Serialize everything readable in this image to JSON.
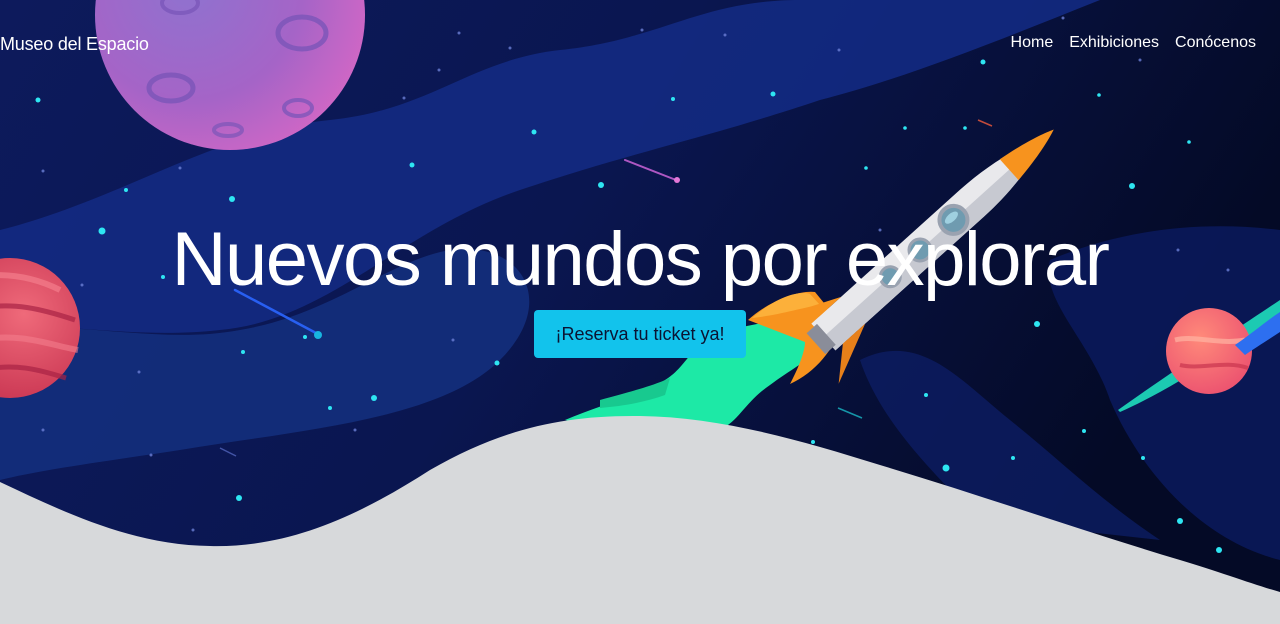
{
  "navbar": {
    "brand": "Museo del Espacio",
    "links": [
      {
        "label": "Home"
      },
      {
        "label": "Exhibiciones"
      },
      {
        "label": "Conócenos"
      }
    ]
  },
  "hero": {
    "headline": "Nuevos mundos por explorar",
    "cta_label": "¡Reserva tu ticket ya!"
  },
  "colors": {
    "space_dark": "#0a1440",
    "accent_cyan": "#12c3ec",
    "ground": "#d7d9db",
    "planet_purple": "#b45fc8",
    "planet_red": "#d9415a",
    "planet_pink": "#f0606e",
    "rocket_flame_green": "#1de9a6",
    "rocket_orange": "#f7931e"
  }
}
